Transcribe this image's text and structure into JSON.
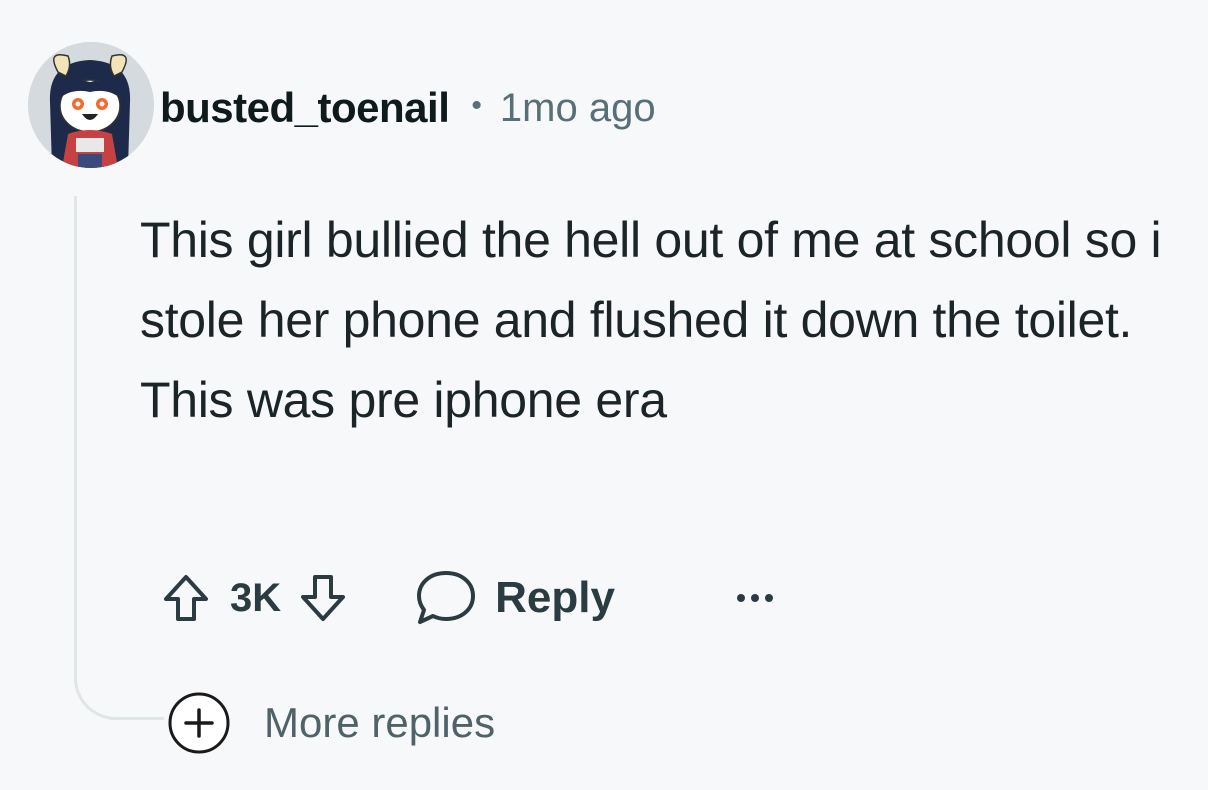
{
  "comment": {
    "username": "busted_toenail",
    "separator": "•",
    "timestamp": "1mo ago",
    "body": "This girl bullied the hell out of me at school so i stole her phone and flushed it down the toilet. This was pre iphone era"
  },
  "actions": {
    "score": "3K",
    "reply_label": "Reply",
    "upvote_icon": "arrow-up-outline-icon",
    "downvote_icon": "arrow-down-outline-icon",
    "reply_icon": "speech-bubble-icon",
    "more_icon": "ellipsis-icon"
  },
  "thread": {
    "more_replies_label": "More replies",
    "expand_icon": "plus-circle-icon"
  },
  "colors": {
    "background": "#f7f8fa",
    "text_primary": "#1b2426",
    "text_secondary": "#576f76",
    "thread_line": "#e0e5e8"
  }
}
